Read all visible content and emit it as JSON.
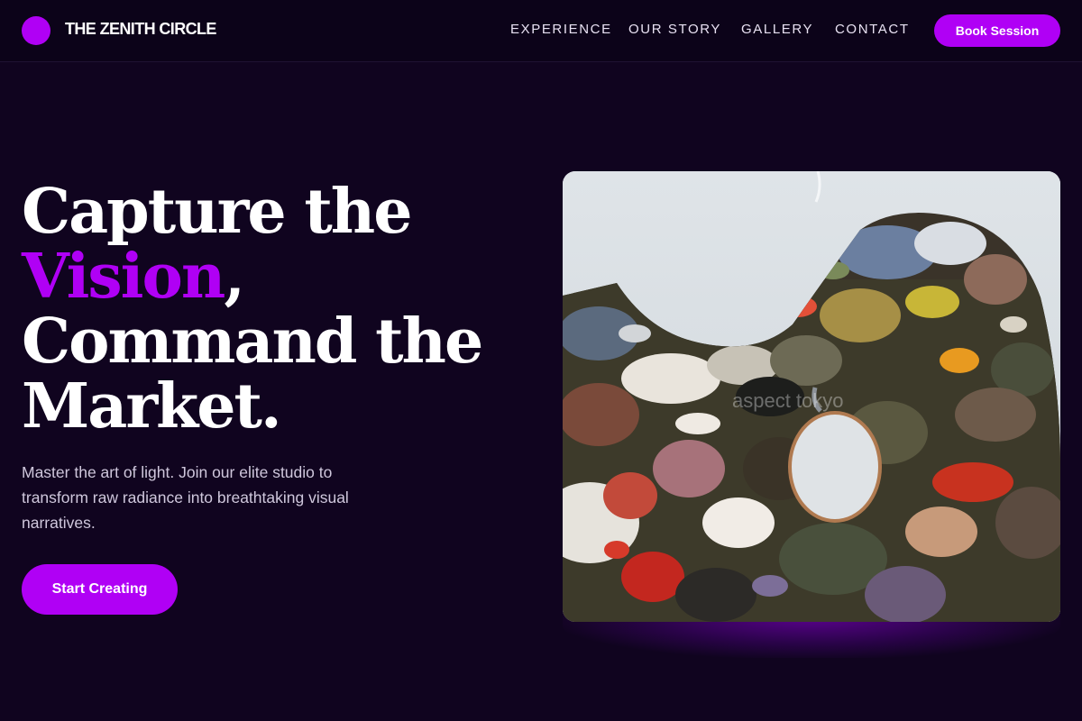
{
  "header": {
    "brand": "THE ZENITH CIRCLE",
    "nav": [
      {
        "label": "EXPERIENCE"
      },
      {
        "label": "OUR STORY"
      },
      {
        "label": "GALLERY"
      },
      {
        "label": "CONTACT"
      }
    ],
    "cta_label": "Book Session"
  },
  "hero": {
    "title_line1": "Capture the",
    "title_accent": "Vision",
    "title_comma": ",",
    "title_line3": "Command the",
    "title_line4": "Market.",
    "description": "Master the art of light. Join our elite studio to transform raw radiance into breathtaking visual narratives.",
    "cta_label": "Start Creating",
    "image_watermark": "aspect tokyo"
  },
  "colors": {
    "accent": "#b000f5",
    "background": "#10041f",
    "nav_background": "#0c0319",
    "body_text": "#cfc7dc"
  },
  "icons": {
    "logo": "circle-logo-icon"
  }
}
